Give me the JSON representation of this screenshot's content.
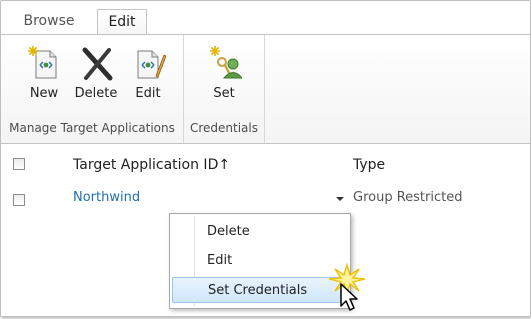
{
  "tabs": [
    {
      "label": "Browse",
      "active": false
    },
    {
      "label": "Edit",
      "active": true
    }
  ],
  "ribbon": {
    "groups": [
      {
        "label": "Manage Target Applications",
        "buttons": [
          {
            "label": "New",
            "icon": "new-document-icon"
          },
          {
            "label": "Delete",
            "icon": "delete-x-icon"
          },
          {
            "label": "Edit",
            "icon": "edit-document-icon"
          }
        ]
      },
      {
        "label": "Credentials",
        "buttons": [
          {
            "label": "Set",
            "icon": "set-credentials-icon"
          }
        ]
      }
    ]
  },
  "list": {
    "columns": [
      "Target Application ID↑",
      "Type"
    ],
    "rows": [
      {
        "id": "Northwind",
        "type": "Group Restricted"
      }
    ]
  },
  "context_menu": {
    "items": [
      "Delete",
      "Edit",
      "Set Credentials"
    ],
    "highlighted": "Set Credentials"
  },
  "colors": {
    "link": "#1f6fb0",
    "highlight": "#cfe6fb"
  }
}
